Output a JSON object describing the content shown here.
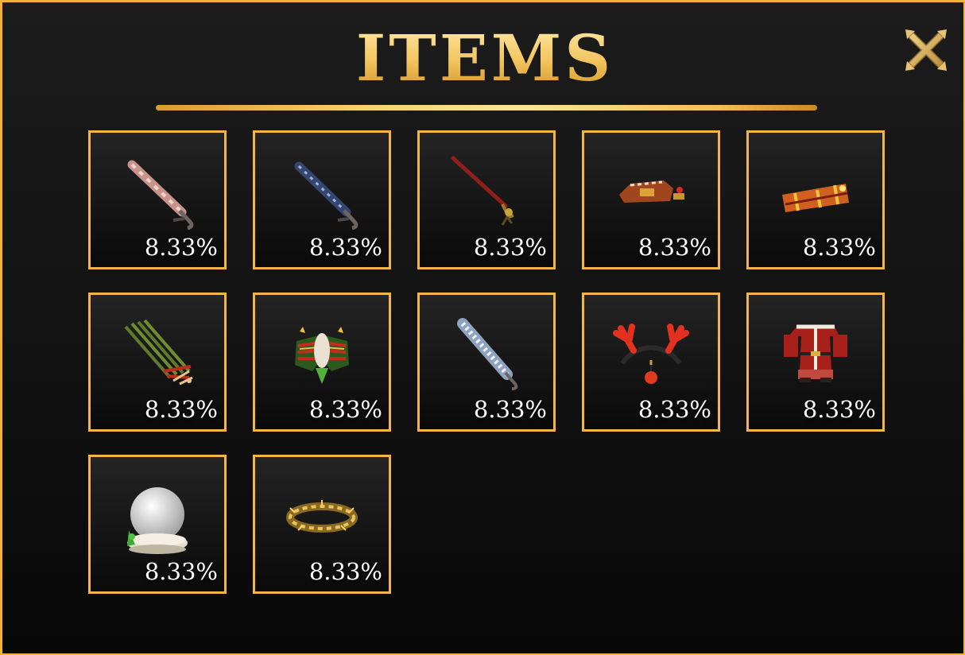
{
  "header": {
    "title": "ITEMS"
  },
  "close_button": {
    "icon": "close-x-icon"
  },
  "colors": {
    "gold": "#f3b545",
    "title_gold": "#f0c25e",
    "background": "#121212",
    "text": "#ffffff"
  },
  "items": [
    {
      "icon": "candy-cane-scythe-icon",
      "chance": "8.33%"
    },
    {
      "icon": "frost-scythe-icon",
      "chance": "8.33%"
    },
    {
      "icon": "red-trident-icon",
      "chance": "8.33%"
    },
    {
      "icon": "gingerbread-cannon-icon",
      "chance": "8.33%"
    },
    {
      "icon": "present-launcher-icon",
      "chance": "8.33%"
    },
    {
      "icon": "candy-rake-icon",
      "chance": "8.33%"
    },
    {
      "icon": "festive-wings-icon",
      "chance": "8.33%"
    },
    {
      "icon": "snow-sword-icon",
      "chance": "8.33%"
    },
    {
      "icon": "reindeer-antlers-icon",
      "chance": "8.33%"
    },
    {
      "icon": "santa-suit-icon",
      "chance": "8.33%"
    },
    {
      "icon": "snow-globe-icon",
      "chance": "8.33%"
    },
    {
      "icon": "golden-halo-icon",
      "chance": "8.33%"
    }
  ]
}
